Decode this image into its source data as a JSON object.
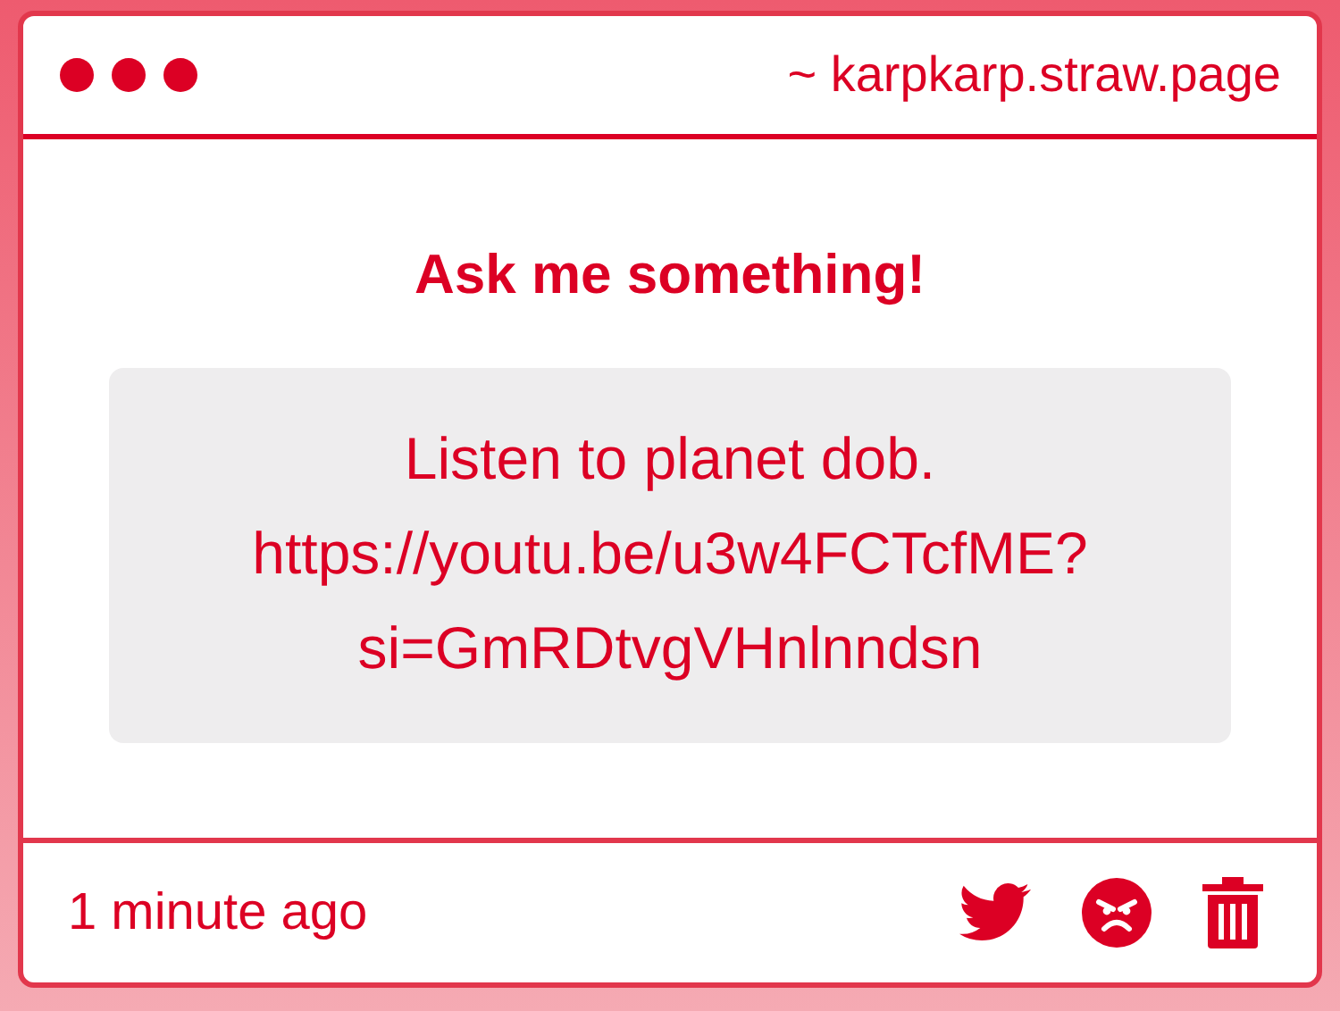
{
  "window": {
    "title": "~ karpkarp.straw.page"
  },
  "heading": "Ask me something!",
  "message_lines": [
    "Listen to planet dob.",
    "https://youtu.be/u3w4FCTcfME?",
    "si=GmRDtvgVHnlnndsn"
  ],
  "footer": {
    "time": "1 minute ago"
  }
}
